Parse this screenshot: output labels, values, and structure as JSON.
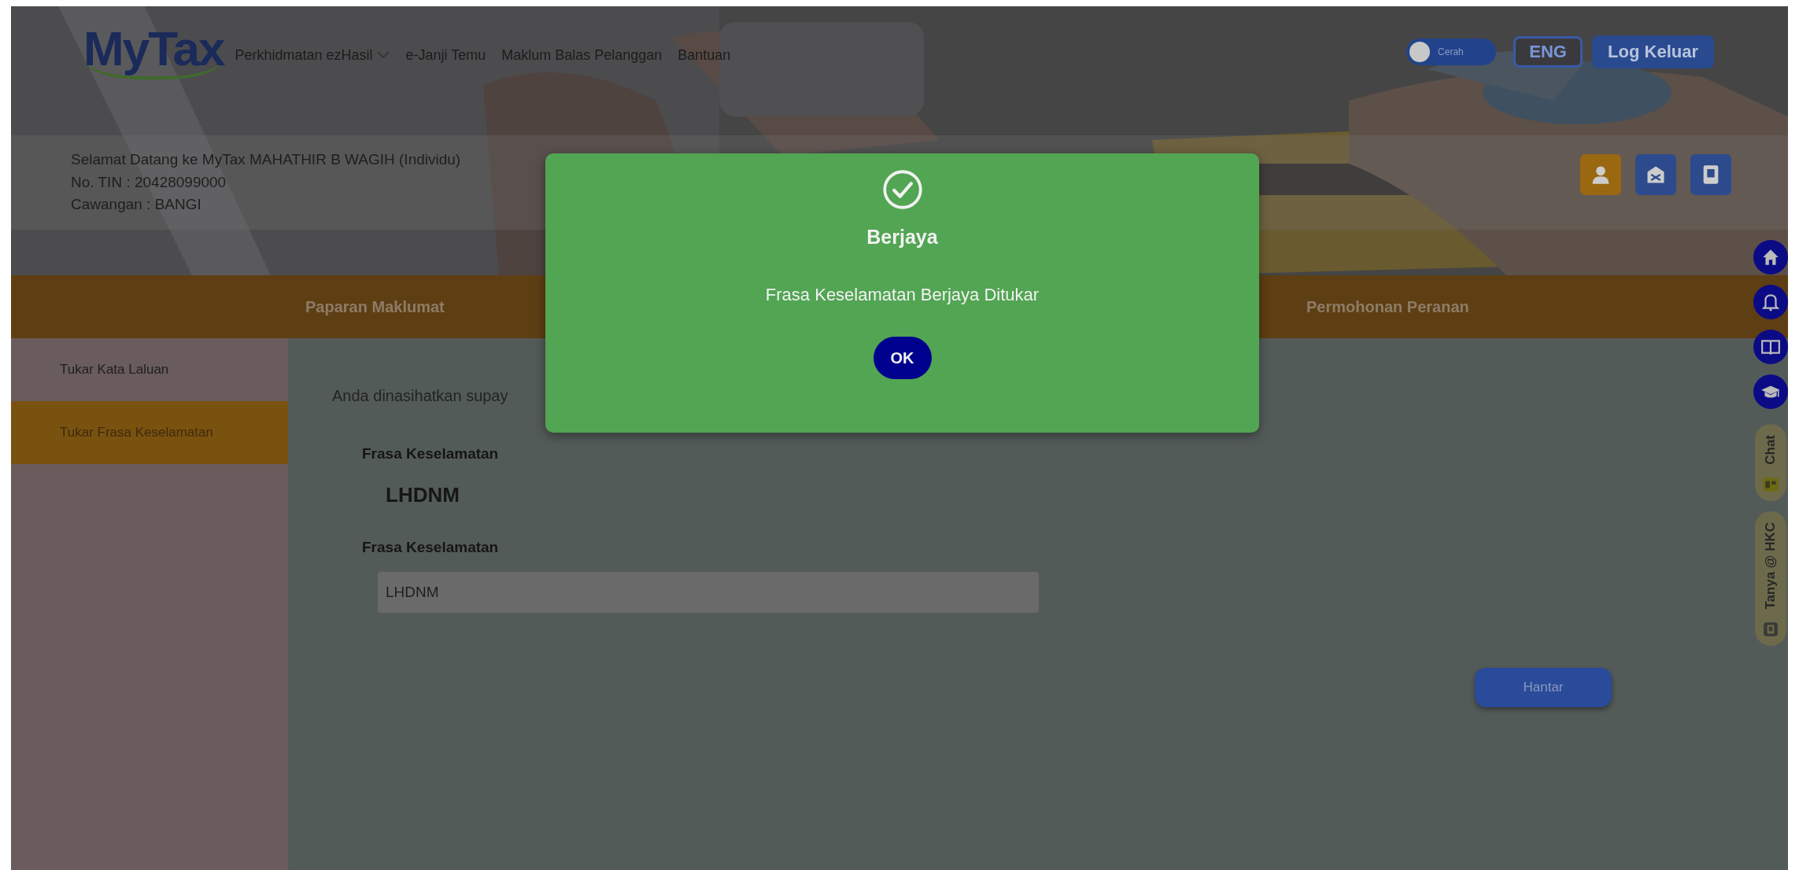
{
  "logo": {
    "text": "MyTax"
  },
  "top_nav": [
    {
      "label": "Perkhidmatan ezHasil",
      "dropdown": true
    },
    {
      "label": "e-Janji Temu",
      "dropdown": false
    },
    {
      "label": "Maklum Balas Pelanggan",
      "dropdown": false
    },
    {
      "label": "Bantuan",
      "dropdown": false
    }
  ],
  "theme_toggle": {
    "label": "Cerah",
    "on": false
  },
  "language_button": "ENG",
  "logout_button": "Log Keluar",
  "welcome": {
    "greeting": "Selamat Datang ke MyTax MAHATHIR B WAGIH (Individu)",
    "tin": "No. TIN : 20428099000",
    "branch": "Cawangan : BANGI"
  },
  "header_icons": [
    {
      "kind": "profile",
      "selected": true
    },
    {
      "kind": "mail",
      "selected": false
    },
    {
      "kind": "document",
      "selected": false
    }
  ],
  "main_tabs": [
    "Paparan Maklumat",
    "Permohonan Peranan"
  ],
  "sidebar": {
    "items": [
      {
        "label": "Tukar Kata Laluan",
        "selected": false
      },
      {
        "label": "Tukar Frasa Keselamatan",
        "selected": true
      }
    ]
  },
  "form": {
    "notice": "Anda dinasihatkan supay",
    "current_label": "Frasa Keselamatan",
    "current_value": "LHDNM",
    "new_label": "Frasa Keselamatan",
    "new_value": "LHDNM",
    "submit": "Hantar"
  },
  "floating_buttons": [
    {
      "kind": "home"
    },
    {
      "kind": "bell"
    },
    {
      "kind": "book"
    },
    {
      "kind": "graduation"
    }
  ],
  "side_tabs": [
    {
      "label": "Chat",
      "kind": "chat"
    },
    {
      "label": "Tanya @ HKC",
      "kind": "hkc"
    }
  ],
  "dialog": {
    "kind": "success",
    "title": "Berjaya",
    "message": "Frasa Keselamatan Berjaya Ditukar",
    "button": "OK"
  }
}
